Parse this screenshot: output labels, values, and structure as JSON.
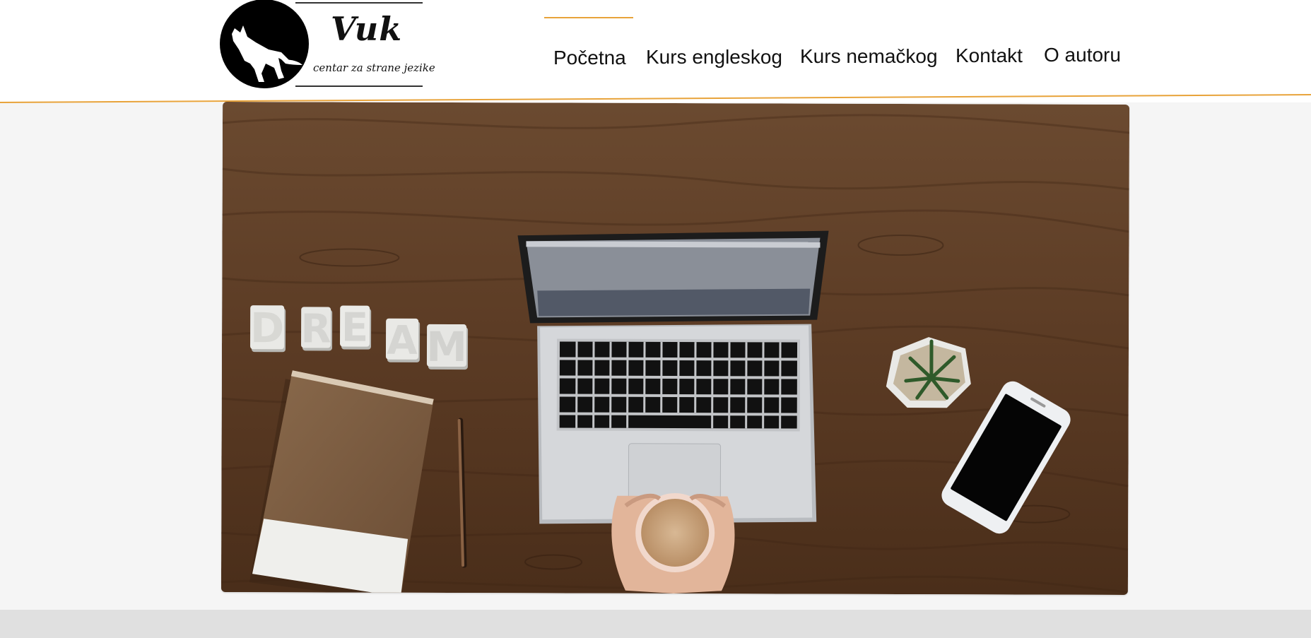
{
  "brand": {
    "name": "Vuk",
    "tagline": "centar za strane jezike"
  },
  "nav": {
    "items": [
      {
        "label": "Početna",
        "active": true
      },
      {
        "label": "Kurs engleskog",
        "active": false
      },
      {
        "label": "Kurs nemačkog",
        "active": false
      },
      {
        "label": "Kontakt",
        "active": false
      },
      {
        "label": "O autoru",
        "active": false
      }
    ]
  },
  "hero": {
    "dream_word": "DREAM"
  },
  "colors": {
    "accent": "#e8a33a",
    "wood": "#5a3a22",
    "page_bg": "#f5f5f5"
  },
  "icons": {
    "logo": "wolf-howling-moon-icon"
  }
}
